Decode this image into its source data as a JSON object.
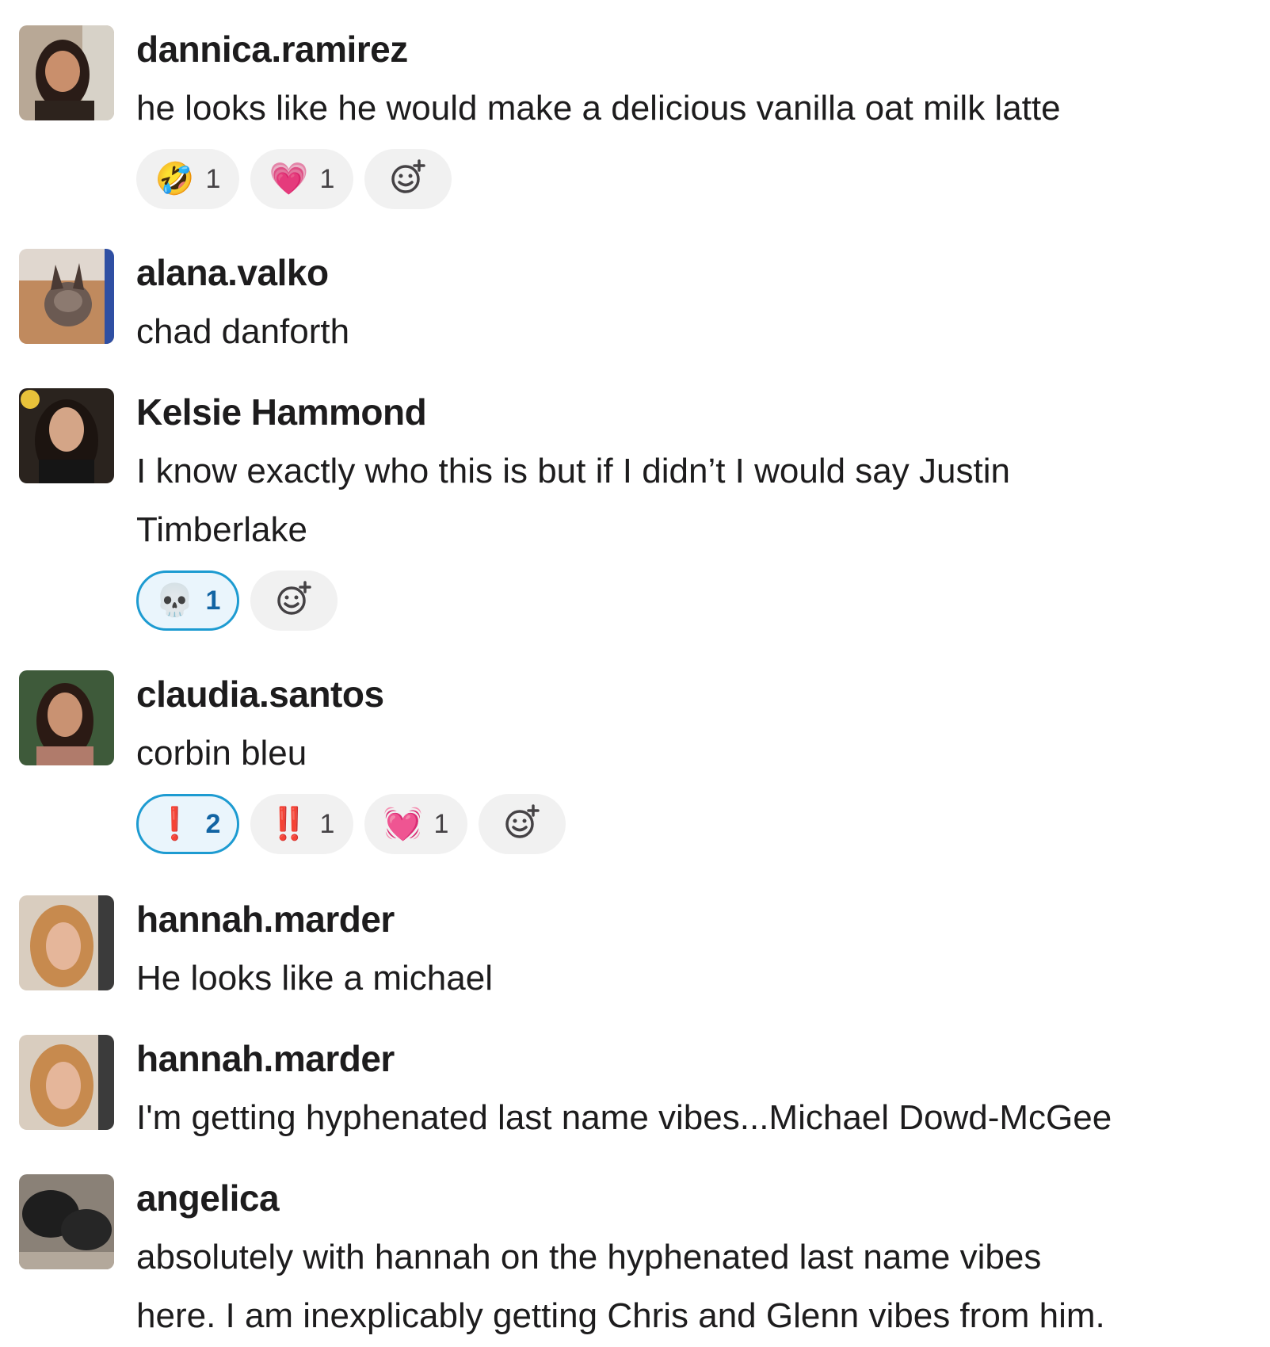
{
  "messages": [
    {
      "username": "dannica.ramirez",
      "text": "he looks like he would make a delicious vanilla oat milk latte",
      "reactions": [
        {
          "emoji": "🤣",
          "count": "1"
        },
        {
          "emoji": "💗",
          "count": "1"
        }
      ]
    },
    {
      "username": "alana.valko",
      "text": "chad danforth"
    },
    {
      "username": "Kelsie Hammond",
      "text_lines": [
        "I know exactly who this is but if I didn’t I would say Justin",
        "Timberlake"
      ],
      "reactions": [
        {
          "emoji": "💀",
          "count": "1"
        }
      ]
    },
    {
      "username": "claudia.santos",
      "text": "corbin bleu",
      "reactions": [
        {
          "emoji": "❗",
          "count": "2"
        },
        {
          "emoji": "‼️",
          "count": "1"
        },
        {
          "emoji": "💓",
          "count": "1"
        }
      ]
    },
    {
      "username": "hannah.marder",
      "text": "He looks like a michael"
    },
    {
      "username": "hannah.marder",
      "text": "I'm getting hyphenated last name vibes...Michael Dowd-McGee"
    },
    {
      "username": "angelica",
      "text_lines": [
        "absolutely with hannah on the hyphenated last name vibes",
        "here. I am inexplicably getting Chris and Glenn vibes from him."
      ]
    }
  ],
  "icons": {
    "add_reaction": "add-reaction-icon"
  }
}
